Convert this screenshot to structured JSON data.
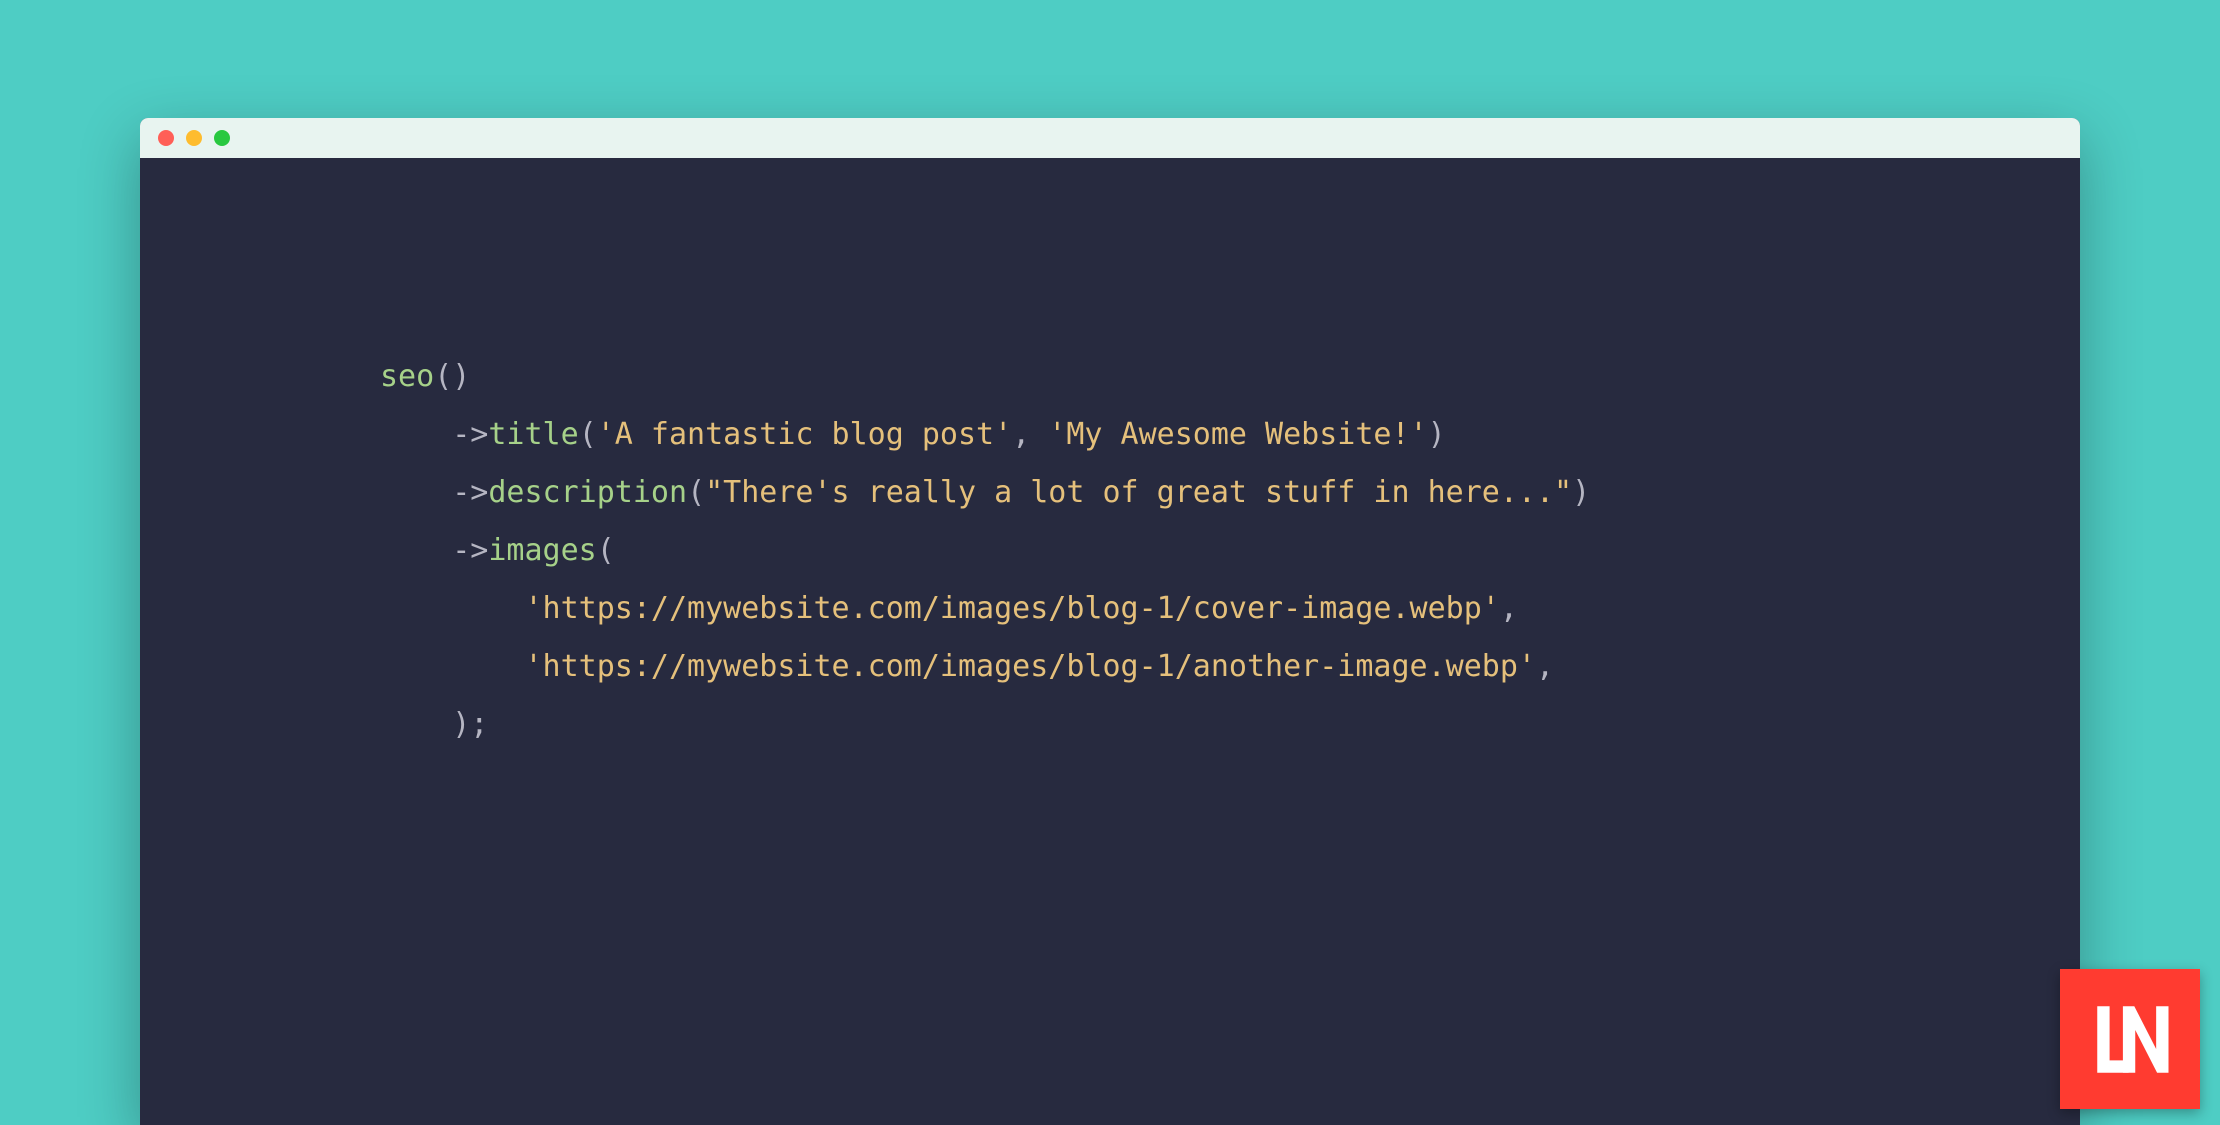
{
  "window": {
    "traffic_lights": [
      "close",
      "minimize",
      "maximize"
    ]
  },
  "code": {
    "line1": {
      "fn": "seo",
      "paren": "()"
    },
    "line2": {
      "arrow": "->",
      "method": "title",
      "open": "(",
      "arg1": "'A fantastic blog post'",
      "comma": ", ",
      "arg2": "'My Awesome Website!'",
      "close": ")"
    },
    "line3": {
      "arrow": "->",
      "method": "description",
      "open": "(",
      "arg1": "\"There's really a lot of great stuff in here...\"",
      "close": ")"
    },
    "line4": {
      "arrow": "->",
      "method": "images",
      "open": "("
    },
    "line5": {
      "arg": "'https://mywebsite.com/images/blog-1/cover-image.webp'",
      "comma": ","
    },
    "line6": {
      "arg": "'https://mywebsite.com/images/blog-1/another-image.webp'",
      "comma": ","
    },
    "line7": {
      "close": ");"
    }
  },
  "logo": {
    "text": "LN"
  }
}
